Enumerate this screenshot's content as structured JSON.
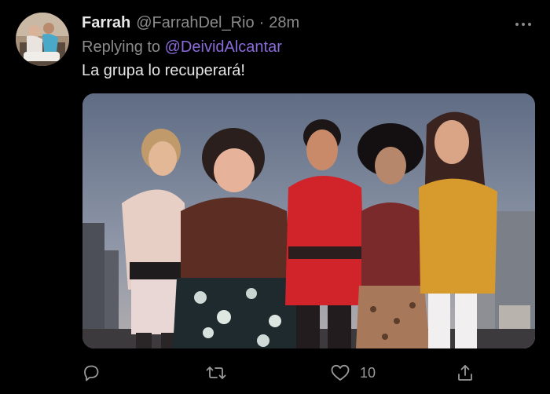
{
  "tweet": {
    "display_name": "Farrah",
    "handle": "@FarrahDel_Rio",
    "separator": "·",
    "time": "28m",
    "reply_prefix": "Replying to",
    "reply_to": "@DeividAlcantar",
    "text": "La grupa lo recuperará!",
    "like_count": "10"
  },
  "icons": {
    "more": "more-options-icon",
    "reply": "reply-icon",
    "retweet": "retweet-icon",
    "like": "heart-icon",
    "share": "share-icon"
  },
  "colors": {
    "background": "#000000",
    "mention": "#8a6bd9",
    "secondary_text": "#8b8b8b"
  }
}
